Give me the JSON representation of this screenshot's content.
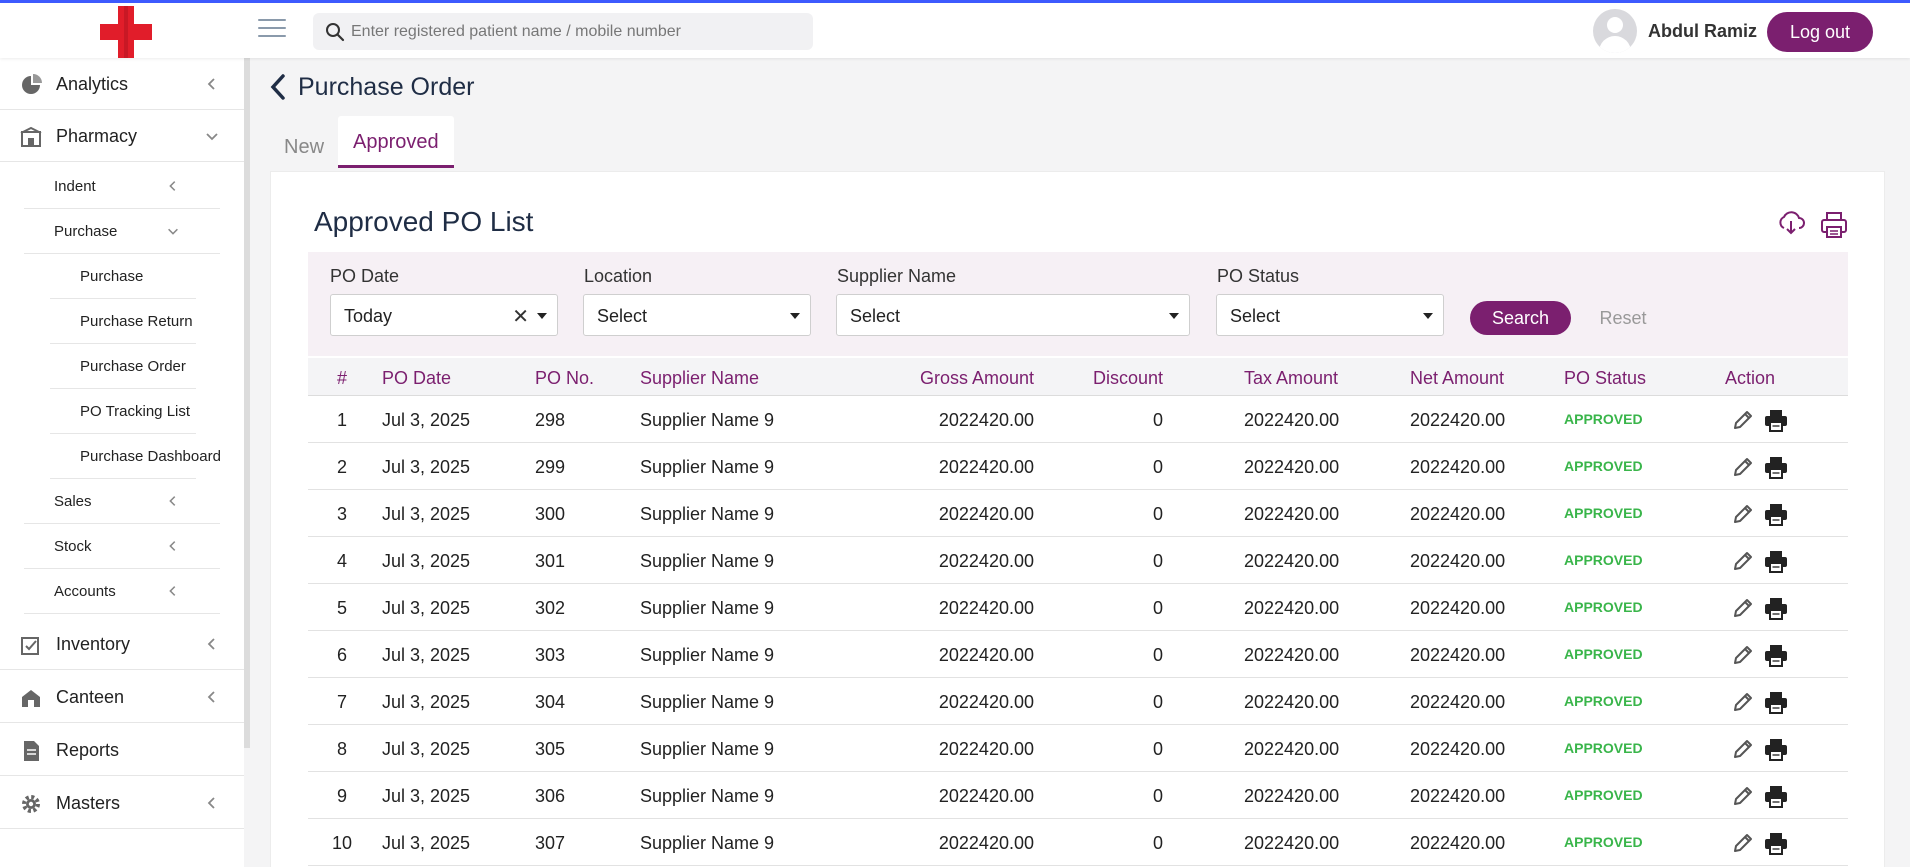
{
  "header": {
    "search_placeholder": "Enter registered patient name / mobile number",
    "username": "Abdul Ramiz",
    "logout_label": "Log out"
  },
  "sidebar": {
    "analytics": "Analytics",
    "pharmacy": "Pharmacy",
    "indent": "Indent",
    "purchase_group": "Purchase",
    "purchase": "Purchase",
    "purchase_return": "Purchase Return",
    "purchase_order": "Purchase Order",
    "po_tracking": "PO Tracking List",
    "purchase_dashboard": "Purchase Dashboard",
    "sales": "Sales",
    "stock": "Stock",
    "accounts": "Accounts",
    "inventory": "Inventory",
    "canteen": "Canteen",
    "reports": "Reports",
    "masters": "Masters"
  },
  "page": {
    "title": "Purchase Order",
    "tabs": {
      "new": "New",
      "approved": "Approved"
    },
    "card_title": "Approved PO List"
  },
  "filters": {
    "po_date_label": "PO Date",
    "po_date_value": "Today",
    "location_label": "Location",
    "location_value": "Select",
    "supplier_label": "Supplier Name",
    "supplier_value": "Select",
    "status_label": "PO Status",
    "status_value": "Select",
    "search_label": "Search",
    "reset_label": "Reset"
  },
  "table": {
    "headers": [
      "#",
      "PO Date",
      "PO No.",
      "Supplier Name",
      "Gross Amount",
      "Discount",
      "Tax Amount",
      "Net Amount",
      "PO Status",
      "Action"
    ],
    "rows": [
      [
        "1",
        "Jul 3, 2025",
        "298",
        "Supplier Name 9",
        "2022420.00",
        "0",
        "2022420.00",
        "2022420.00",
        "APPROVED"
      ],
      [
        "2",
        "Jul 3, 2025",
        "299",
        "Supplier Name 9",
        "2022420.00",
        "0",
        "2022420.00",
        "2022420.00",
        "APPROVED"
      ],
      [
        "3",
        "Jul 3, 2025",
        "300",
        "Supplier Name 9",
        "2022420.00",
        "0",
        "2022420.00",
        "2022420.00",
        "APPROVED"
      ],
      [
        "4",
        "Jul 3, 2025",
        "301",
        "Supplier Name 9",
        "2022420.00",
        "0",
        "2022420.00",
        "2022420.00",
        "APPROVED"
      ],
      [
        "5",
        "Jul 3, 2025",
        "302",
        "Supplier Name 9",
        "2022420.00",
        "0",
        "2022420.00",
        "2022420.00",
        "APPROVED"
      ],
      [
        "6",
        "Jul 3, 2025",
        "303",
        "Supplier Name 9",
        "2022420.00",
        "0",
        "2022420.00",
        "2022420.00",
        "APPROVED"
      ],
      [
        "7",
        "Jul 3, 2025",
        "304",
        "Supplier Name 9",
        "2022420.00",
        "0",
        "2022420.00",
        "2022420.00",
        "APPROVED"
      ],
      [
        "8",
        "Jul 3, 2025",
        "305",
        "Supplier Name 9",
        "2022420.00",
        "0",
        "2022420.00",
        "2022420.00",
        "APPROVED"
      ],
      [
        "9",
        "Jul 3, 2025",
        "306",
        "Supplier Name 9",
        "2022420.00",
        "0",
        "2022420.00",
        "2022420.00",
        "APPROVED"
      ],
      [
        "10",
        "Jul 3, 2025",
        "307",
        "Supplier Name 9",
        "2022420.00",
        "0",
        "2022420.00",
        "2022420.00",
        "APPROVED"
      ]
    ]
  },
  "colors": {
    "brand": "#7b1f6f",
    "status_approved": "#39b54a",
    "top_accent": "#3d5afe"
  },
  "icons": [
    "hamburger-menu-icon",
    "search-icon",
    "user-avatar-icon",
    "pie-chart-icon",
    "pharmacy-store-icon",
    "chevron-left-icon",
    "chevron-down-icon",
    "inventory-icon",
    "canteen-icon",
    "report-icon",
    "gear-icon",
    "back-arrow-icon",
    "cloud-download-icon",
    "printer-icon",
    "pencil-edit-icon"
  ]
}
